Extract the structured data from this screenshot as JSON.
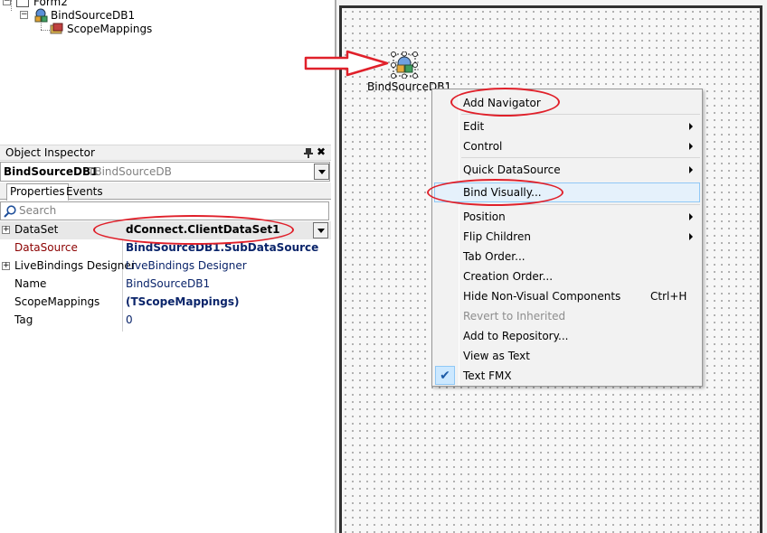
{
  "structure": {
    "nodes": [
      {
        "label": "Form2"
      },
      {
        "label": "BindSourceDB1"
      },
      {
        "label": "ScopeMappings"
      }
    ]
  },
  "inspector": {
    "title": "Object Inspector",
    "selected_object": "BindSourceDB1",
    "selected_type": "TBindSourceDB",
    "tabs": [
      {
        "label": "Properties"
      },
      {
        "label": "Events"
      }
    ],
    "search_placeholder": "Search",
    "properties": [
      {
        "name": "DataSet",
        "value": "dConnect.ClientDataSet1"
      },
      {
        "name": "DataSource",
        "value": "BindSourceDB1.SubDataSource"
      },
      {
        "name": "LiveBindings Designer",
        "value": "LiveBindings Designer"
      },
      {
        "name": "Name",
        "value": "BindSourceDB1"
      },
      {
        "name": "ScopeMappings",
        "value": "(TScopeMappings)"
      },
      {
        "name": "Tag",
        "value": "0"
      }
    ]
  },
  "designer": {
    "component_label": "BindSourceDB1"
  },
  "context_menu": {
    "items": [
      {
        "label": "Add Navigator"
      },
      {
        "label": "Edit"
      },
      {
        "label": "Control"
      },
      {
        "label": "Quick DataSource"
      },
      {
        "label": "Bind Visually..."
      },
      {
        "label": "Position"
      },
      {
        "label": "Flip Children"
      },
      {
        "label": "Tab Order..."
      },
      {
        "label": "Creation Order..."
      },
      {
        "label": "Hide Non-Visual Components",
        "shortcut": "Ctrl+H"
      },
      {
        "label": "Revert to Inherited"
      },
      {
        "label": "Add to Repository..."
      },
      {
        "label": "View as Text"
      },
      {
        "label": "Text FMX"
      }
    ]
  },
  "colors": {
    "annotation_red": "#e0202a",
    "menu_highlight": "#e5f1fb",
    "value_blue": "#0a246a"
  }
}
